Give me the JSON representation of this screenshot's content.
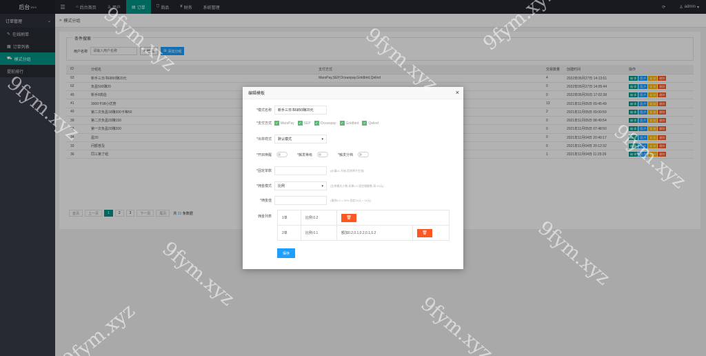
{
  "topbar": {
    "logo": "后台",
    "version": "V1.0",
    "nav": [
      {
        "icon": "home-icon",
        "label": "后台首页"
      },
      {
        "icon": "user-icon",
        "label": "用户"
      },
      {
        "icon": "list-icon",
        "label": "订单"
      },
      {
        "icon": "cart-icon",
        "label": "商品"
      },
      {
        "icon": "yen-icon",
        "label": "财务"
      },
      {
        "icon": "",
        "label": "系统管理"
      }
    ],
    "active_nav": "订单",
    "user": "admin"
  },
  "sidebar": {
    "group": "订单管理",
    "items": [
      {
        "icon": "edit-icon",
        "label": "在线刷单"
      },
      {
        "icon": "doc-icon",
        "label": "订单列表"
      },
      {
        "icon": "car-icon",
        "label": "模式分组"
      },
      {
        "icon": "",
        "label": "提前排行"
      }
    ],
    "active_item": "模式分组"
  },
  "breadcrumb": "模式分组",
  "search": {
    "legend": "条件搜索",
    "label": "用户名称",
    "placeholder": "请输入用户名称",
    "search_label": "搜 索",
    "add_label": "添加分组"
  },
  "table": {
    "headers": [
      "ID",
      "分组名",
      "支付方式",
      "交易数量",
      "创建时间",
      "操作"
    ],
    "rows": [
      {
        "id": "63",
        "name": "新手三日书6850赚20元",
        "pay": "MarsPay,SEP,Oceanpay,Goldbird,Qelind",
        "count": "4",
        "time": "2022年05月27日 14:13:51"
      },
      {
        "id": "62",
        "name": "负盈500赚20",
        "pay": "",
        "count": "0",
        "time": "2022年05月27日 14:05:44"
      },
      {
        "id": "45",
        "name": "新手8高信",
        "pay": "",
        "count": "0",
        "time": "2022年05月26日 17:02:38"
      },
      {
        "id": "41",
        "name": "3000卡98小优势",
        "pay": "",
        "count": "13",
        "time": "2021年11月05日 09:45:49"
      },
      {
        "id": "40",
        "name": "第二次负盈18赚300卡等50",
        "pay": "",
        "count": "2",
        "time": "2021年11月05日 09:00:59"
      },
      {
        "id": "39",
        "name": "第二次负盈20赚150",
        "pay": "",
        "count": "0",
        "time": "2021年11月05日 08:49:54"
      },
      {
        "id": "38",
        "name": "第一次负盈20赚200",
        "pay": "",
        "count": "0",
        "time": "2021年11月05日 07:48:50"
      },
      {
        "id": "34",
        "name": "盈20",
        "pay": "",
        "count": "0",
        "time": "2021年11月04日 20:40:17"
      },
      {
        "id": "33",
        "name": "问额普及",
        "pay": "",
        "count": "0",
        "time": "2021年11月04日 20:12:32"
      },
      {
        "id": "36",
        "name": "同三第了组",
        "pay": "",
        "count": "1",
        "time": "2021年11月04日 11:25:26"
      }
    ],
    "ops": [
      "编 辑",
      "用 户",
      "复 制",
      "删除"
    ]
  },
  "pager": {
    "first": "首页",
    "prev": "上一页",
    "pages": [
      "1",
      "2",
      "3"
    ],
    "next": "下一页",
    "last": "尾页",
    "total_prefix": "共",
    "total": "21",
    "total_suffix": "条数据"
  },
  "modal": {
    "title": "编辑模板",
    "name_label": "*模式名称",
    "name_value": "新手三日书6850赚20元",
    "pay_label": "*支付方式",
    "pay_options": [
      "MarsPay",
      "SEP",
      "Oceanpay",
      "Goldbird",
      "Qelind"
    ],
    "order_style_label": "*出单样式",
    "order_style_value": "默认模式",
    "toggle_label_1": "*开启唤醒",
    "toggle_label_2": "*触发等级",
    "toggle_label_3": "*触发分档",
    "fixed_count_label": "*固定单数",
    "fixed_count_hint": "(必填≥1 开始,否则将不生效)",
    "commission_mode_label": "*佣金模式",
    "commission_mode_value": "比例",
    "commission_mode_hint": "(比例模式小数,如果0.2 固定模额数,如:10元)",
    "commission_value_label": "*佣金值",
    "commission_value_hint": "(填例0.2 = 20% 固定10元 = 10元)",
    "tiers_label": "佣金列表",
    "tiers": [
      {
        "tier": "1单",
        "ratio": "比例:0.2",
        "extra": ""
      },
      {
        "tier": "2单",
        "ratio": "比例:0.1",
        "extra": "额加0.2,0.1,0.2,0.1,0.2"
      }
    ],
    "save_label": "保存",
    "close_glyph": "×",
    "delete_glyph": "🗑"
  },
  "watermark": "9fym.xyz",
  "colors": {
    "accent": "#009688",
    "blue": "#1e9fff",
    "danger": "#ff5722",
    "warn": "#ffb800",
    "topbar": "#23262e",
    "sidebar": "#393d49"
  }
}
